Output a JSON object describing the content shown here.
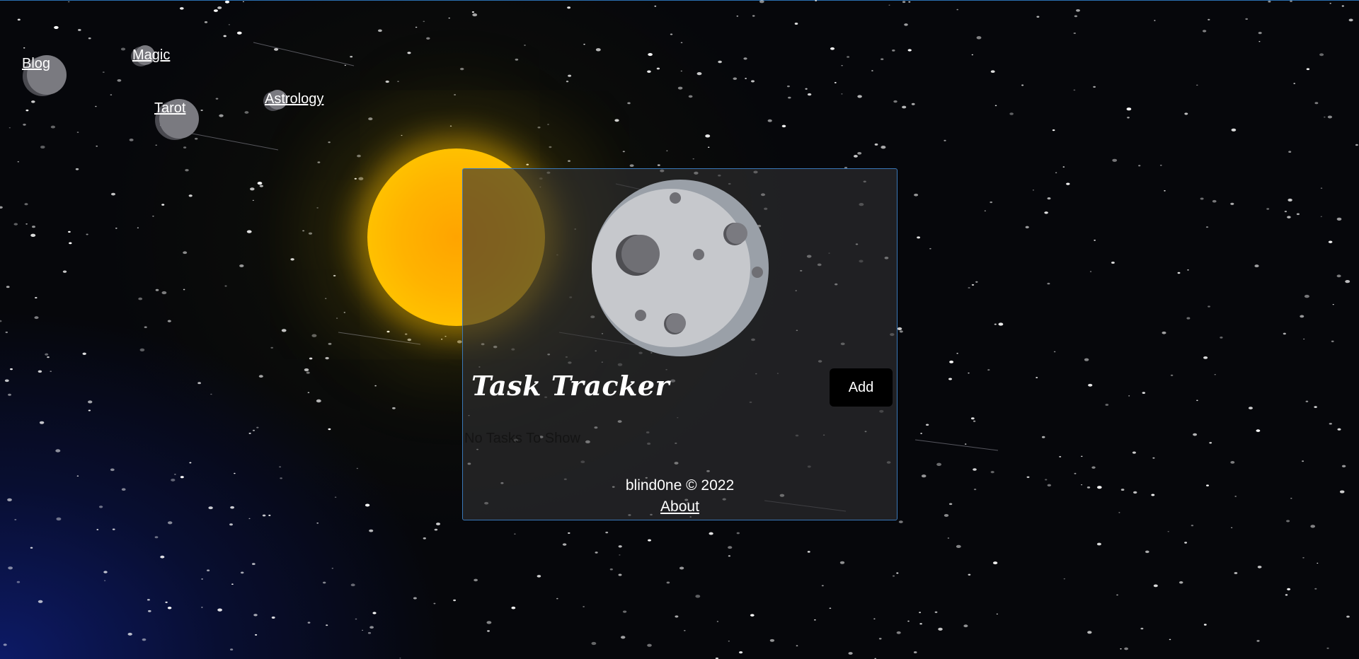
{
  "nav": {
    "blog": "Blog",
    "magic": "Magic",
    "tarot": "Tarot",
    "astrology": "Astrology"
  },
  "task_card": {
    "title": "Task Tracker",
    "add_label": "Add",
    "empty_message": "No Tasks To Show",
    "footer_copyright": "blind0ne © 2022",
    "footer_about": "About"
  },
  "icons": {
    "sun": "sun-icon",
    "moon": "moon-icon",
    "nav_planet": "planet-icon"
  },
  "colors": {
    "card_border": "#3a78b8",
    "sun": "#ffb300",
    "add_button": "#000000",
    "moon": "#c6c8cc"
  }
}
